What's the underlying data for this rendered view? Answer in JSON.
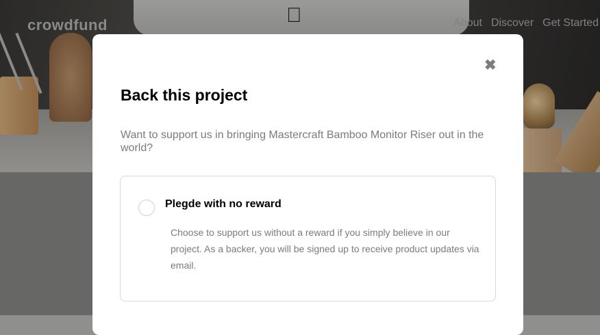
{
  "header": {
    "logo": "crowdfund",
    "nav": [
      {
        "label": "About"
      },
      {
        "label": "Discover"
      },
      {
        "label": "Get Started"
      }
    ]
  },
  "modal": {
    "close_symbol": "✖",
    "title": "Back this project",
    "intro": "Want to support us in bringing Mastercraft Bamboo Monitor Riser out in the world?",
    "pledge": {
      "title": "Plegde with no reward",
      "description": "Choose to support us without a reward if you simply believe in our project. As a backer, you will be signed up to receive product updates via email."
    }
  },
  "colors": {
    "overlay": "#8f908d",
    "modal_bg": "#ffffff",
    "muted_text": "#7b7b7b",
    "border": "#d8d8d8"
  },
  "icons": {
    "close": "close-icon",
    "brand": "apple-logo-icon"
  }
}
